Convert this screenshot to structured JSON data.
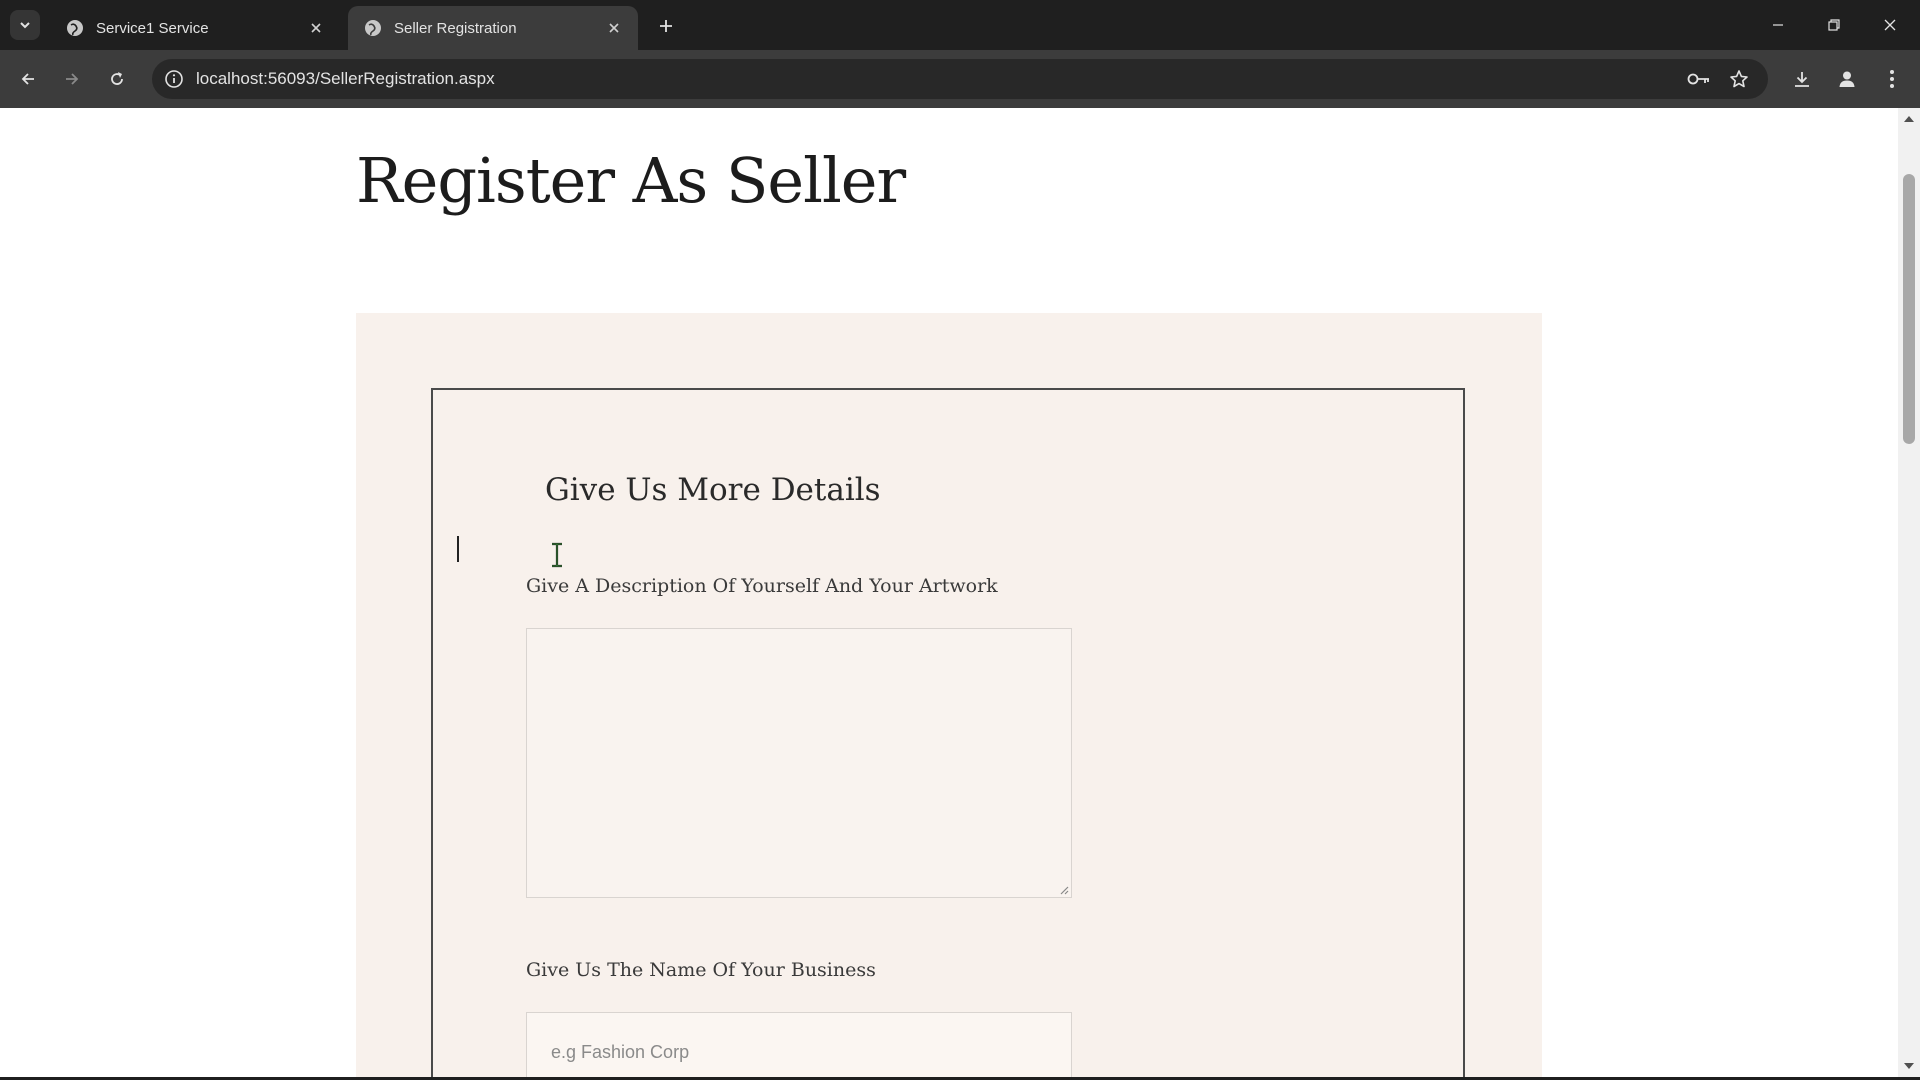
{
  "browser": {
    "tabs": [
      {
        "title": "Service1 Service",
        "active": false
      },
      {
        "title": "Seller Registration",
        "active": true
      }
    ],
    "url": "localhost:56093/SellerRegistration.aspx",
    "icons": [
      "tab-search-icon",
      "globe-icon",
      "close-icon",
      "plus-icon",
      "back-arrow-icon",
      "forward-arrow-icon",
      "reload-icon",
      "info-icon",
      "key-icon",
      "star-icon",
      "download-icon",
      "profile-icon",
      "kebab-menu-icon",
      "minimize-icon",
      "restore-icon",
      "window-close-icon"
    ]
  },
  "page": {
    "title": "Register As Seller",
    "card_title": "Give Us More Details",
    "description_label": "Give A Description Of Yourself And Your Artwork",
    "description_value": "",
    "business_label": "Give Us The Name Of Your Business",
    "business_placeholder": "e.g Fashion Corp"
  },
  "colors": {
    "titlebar": "#1f1f1f",
    "toolbar": "#3c3c3c",
    "panel_bg": "#f8f1ec",
    "card_border": "#4a4a4a"
  }
}
